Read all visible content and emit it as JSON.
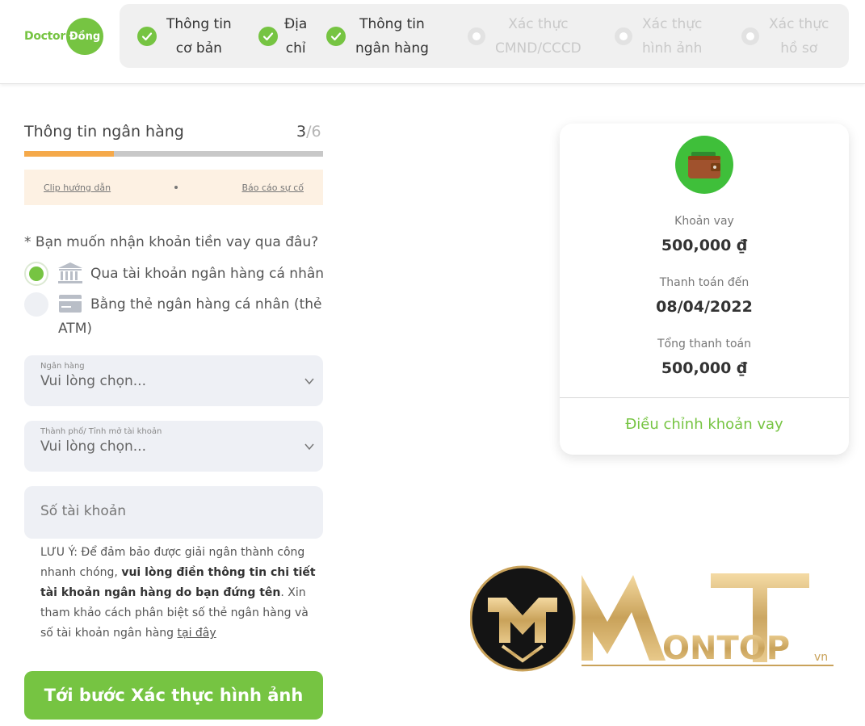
{
  "logo": {
    "part1": "Doctor",
    "part2": "Đồng"
  },
  "steps": [
    {
      "line1": "Thông tin",
      "line2": "cơ bản",
      "state": "done"
    },
    {
      "line1": "Địa",
      "line2": "chỉ",
      "state": "done"
    },
    {
      "line1": "Thông tin",
      "line2": "ngân hàng",
      "state": "done"
    },
    {
      "line1": "Xác thực",
      "line2": "CMND/CCCD",
      "state": "todo"
    },
    {
      "line1": "Xác thực",
      "line2": "hình ảnh",
      "state": "todo"
    },
    {
      "line1": "Xác thực",
      "line2": "hồ sơ",
      "state": "todo"
    }
  ],
  "section": {
    "title": "Thông tin ngân hàng",
    "current": "3",
    "total": "/6",
    "progress_fraction": 0.3
  },
  "guide": {
    "clip_link": "Clip hướng dẫn",
    "report_link": "Báo cáo sự cố"
  },
  "question": "* Bạn muốn nhận khoản tiền vay qua đâu?",
  "options": [
    {
      "label": "Qua tài khoản ngân hàng cá nhân",
      "checked": true,
      "icon": "bank-icon"
    },
    {
      "label": "Bằng thẻ ngân hàng cá nhân (thẻ ATM)",
      "checked": false,
      "icon": "card-icon"
    }
  ],
  "fields": {
    "bank": {
      "label": "Ngân hàng",
      "value": "Vui lòng chọn..."
    },
    "city": {
      "label": "Thành phố/ Tỉnh mở tài khoản",
      "value": "Vui lòng chọn..."
    },
    "account": {
      "placeholder": "Số tài khoản"
    }
  },
  "note": {
    "part1": "LƯU Ý: Để đảm bảo được giải ngân thành công nhanh chóng, ",
    "bold": "vui lòng điền thông tin chi tiết tài khoản ngân hàng do bạn đứng tên",
    "part2": ". Xin tham khảo cách phân biệt số thẻ ngân hàng và số tài khoản ngân hàng ",
    "link": "tại đây"
  },
  "cta": "Tới bước Xác thực hình ảnh",
  "card": {
    "loan_label": "Khoản vay",
    "loan_value": "500,000 ₫",
    "due_label": "Thanh toán đến",
    "due_value": "08/04/2022",
    "total_label": "Tổng thanh toán",
    "total_value": "500,000 ₫",
    "adjust_link": "Điều chỉnh khoản vay"
  },
  "watermark": {
    "text": "ONTOP",
    "suffix": "vn"
  },
  "colors": {
    "brand_green": "#76c442",
    "progress_orange": "#f5a94a",
    "field_bg": "#eef0f5"
  }
}
